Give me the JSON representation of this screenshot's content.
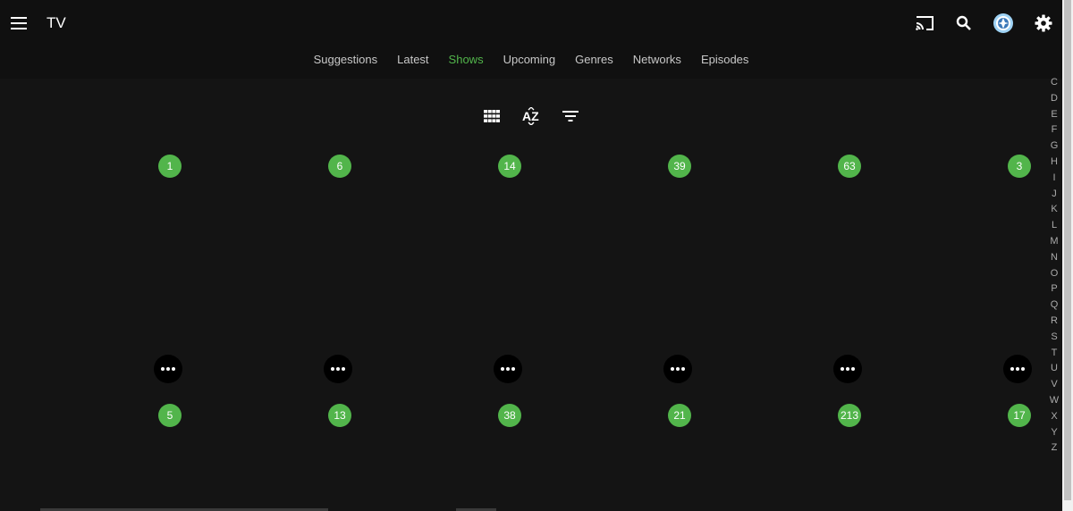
{
  "header": {
    "title": "TV",
    "icons": [
      "menu-icon",
      "cast-icon",
      "search-icon",
      "user-avatar-icon",
      "settings-gear-icon"
    ]
  },
  "tabs": [
    {
      "label": "Suggestions",
      "active": false
    },
    {
      "label": "Latest",
      "active": false
    },
    {
      "label": "Shows",
      "active": true
    },
    {
      "label": "Upcoming",
      "active": false
    },
    {
      "label": "Genres",
      "active": false
    },
    {
      "label": "Networks",
      "active": false
    },
    {
      "label": "Episodes",
      "active": false
    }
  ],
  "toolbar": {
    "icons": [
      "grid-view-icon",
      "sort-az-icon",
      "filter-icon"
    ]
  },
  "rows": [
    {
      "counts": [
        "1",
        "6",
        "14",
        "39",
        "63",
        "3"
      ]
    },
    {
      "counts": [
        "5",
        "13",
        "38",
        "21",
        "213",
        "17"
      ]
    }
  ],
  "alpha_picker": [
    "C",
    "D",
    "E",
    "F",
    "G",
    "H",
    "I",
    "J",
    "K",
    "L",
    "M",
    "N",
    "O",
    "P",
    "Q",
    "R",
    "S",
    "T",
    "U",
    "V",
    "W",
    "X",
    "Y",
    "Z"
  ],
  "colors": {
    "accent": "#52b54b",
    "background": "#141414",
    "header": "#101010"
  }
}
